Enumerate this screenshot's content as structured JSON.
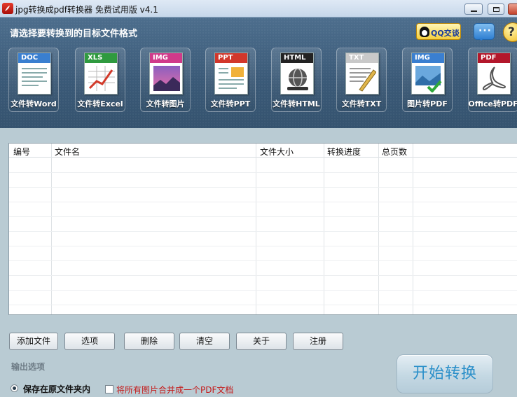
{
  "window": {
    "title": "jpg转换成pdf转换器 免费试用版 v4.1"
  },
  "header": {
    "prompt": "请选择要转换到的目标文件格式",
    "qq_label": "QQ交谈",
    "chat_glyph": "···",
    "help_glyph": "?"
  },
  "tiles": [
    {
      "badge": "DOC",
      "caption": "文件转Word",
      "color": "#3a7fd0"
    },
    {
      "badge": "XLS",
      "caption": "文件转Excel",
      "color": "#2f9a3f"
    },
    {
      "badge": "IMG",
      "caption": "文件转图片",
      "color": "#d03a8a"
    },
    {
      "badge": "PPT",
      "caption": "文件转PPT",
      "color": "#d2372b"
    },
    {
      "badge": "HTML",
      "caption": "文件转HTML",
      "color": "#222222"
    },
    {
      "badge": "TXT",
      "caption": "文件转TXT",
      "color": "#c9c9c9"
    },
    {
      "badge": "IMG",
      "caption": "图片转PDF",
      "color": "#3a7fd0"
    },
    {
      "badge": "PDF",
      "caption": "Office转PDF",
      "color": "#b3172b"
    }
  ],
  "table": {
    "columns": [
      "编号",
      "文件名",
      "文件大小",
      "转换进度",
      "总页数"
    ]
  },
  "buttons": {
    "add": "添加文件",
    "options": "选项",
    "delete": "删除",
    "clear": "清空",
    "about": "关于",
    "register": "注册",
    "start": "开始转换"
  },
  "output": {
    "section_label": "输出选项",
    "radio_label": "保存在原文件夹内",
    "merge_label": "将所有图片合并成一个PDF文档"
  }
}
